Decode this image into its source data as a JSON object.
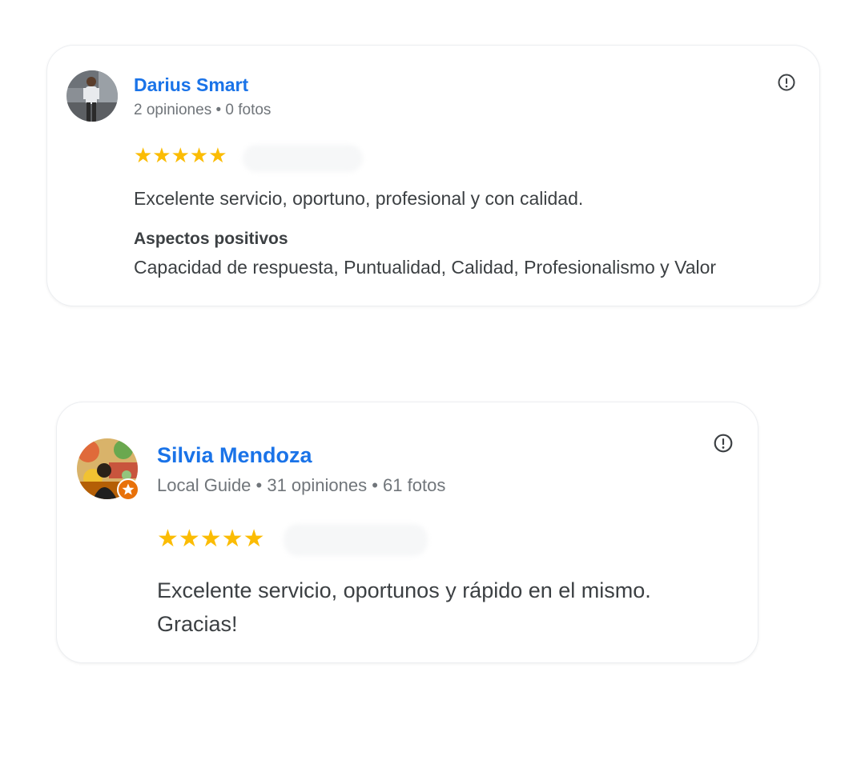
{
  "reviews": [
    {
      "name": "Darius Smart",
      "meta": "2 opiniones • 0 fotos",
      "rating": 5,
      "stars": "★★★★★",
      "text": "Excelente servicio, oportuno, profesional y con calidad.",
      "aspects_title": "Aspectos positivos",
      "aspects": "Capacidad de respuesta, Puntualidad, Calidad, Profesionalismo y Valor",
      "avatar_icon": "person-photo-avatar",
      "flag_icon": "report-icon"
    },
    {
      "name": "Silvia Mendoza",
      "meta": "Local Guide • 31 opiniones • 61 fotos",
      "rating": 5,
      "stars": "★★★★★",
      "text": "Excelente servicio, oportunos y rápido en el mismo. Gracias!",
      "avatar_icon": "local-guide-avatar",
      "badge_icon": "local-guide-star-badge",
      "flag_icon": "report-icon"
    }
  ],
  "colors": {
    "name": "#1a73e8",
    "meta": "#70757a",
    "star": "#fbbc04",
    "text": "#3c4043",
    "badge": "#e8710a"
  }
}
